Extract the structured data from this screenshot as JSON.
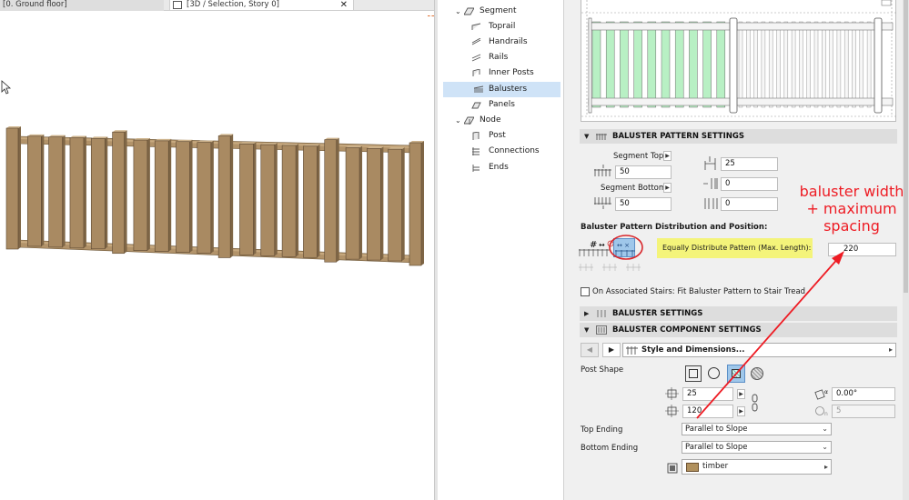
{
  "tabs": {
    "ground_floor": "[0. Ground floor]",
    "selection_3d": "[3D / Selection, Story 0]",
    "close_glyph": "✕"
  },
  "tree": {
    "items": [
      {
        "label": "Segment",
        "level": 0,
        "expanded": true,
        "icon": "segment-icon"
      },
      {
        "label": "Toprail",
        "level": 1,
        "icon": "toprail-icon"
      },
      {
        "label": "Handrails",
        "level": 1,
        "icon": "handrails-icon"
      },
      {
        "label": "Rails",
        "level": 1,
        "icon": "rails-icon"
      },
      {
        "label": "Inner Posts",
        "level": 1,
        "icon": "inner-posts-icon"
      },
      {
        "label": "Balusters",
        "level": 1,
        "icon": "balusters-icon",
        "selected": true
      },
      {
        "label": "Panels",
        "level": 1,
        "icon": "panels-icon"
      },
      {
        "label": "Node",
        "level": 0,
        "expanded": true,
        "icon": "node-icon"
      },
      {
        "label": "Post",
        "level": 1,
        "icon": "post-icon"
      },
      {
        "label": "Connections",
        "level": 1,
        "icon": "connections-icon"
      },
      {
        "label": "Ends",
        "level": 1,
        "icon": "ends-icon"
      }
    ],
    "expand_glyph": "⌄"
  },
  "pattern_settings": {
    "header": "BALUSTER PATTERN SETTINGS",
    "segment_top_label": "Segment Top",
    "segment_top_value": "50",
    "segment_bottom_label": "Segment Bottom",
    "segment_bottom_value": "50",
    "offset_value": "25",
    "field_b": "0",
    "field_c": "0",
    "distribution_title": "Baluster Pattern Distribution and Position:",
    "equally_distribute_label": "Equally Distribute Pattern (Max. Length):",
    "max_length_value": "220",
    "stairs_checkbox_label": "On Associated Stairs: Fit Baluster Pattern to Stair Tread"
  },
  "baluster_settings": {
    "header": "BALUSTER SETTINGS"
  },
  "component_settings": {
    "header": "BALUSTER COMPONENT SETTINGS",
    "style_label": "Style and Dimensions...",
    "post_shape_label": "Post Shape",
    "width_value": "25",
    "depth_value": "120",
    "angle_value": "0.00°",
    "segments_value": "5",
    "top_ending_label": "Top Ending",
    "top_ending_value": "Parallel to Slope",
    "bottom_ending_label": "Bottom Ending",
    "bottom_ending_value": "Parallel to Slope",
    "material_value": "timber"
  },
  "annotation": {
    "line1": "baluster width",
    "line2": "+ maximum",
    "line3": "spacing",
    "color": "#ee1c24"
  },
  "colors": {
    "selection": "#cfe3f7",
    "highlight": "#f4f47a",
    "wood": "#a98a62",
    "baluster_green": "#b8f0c4"
  }
}
